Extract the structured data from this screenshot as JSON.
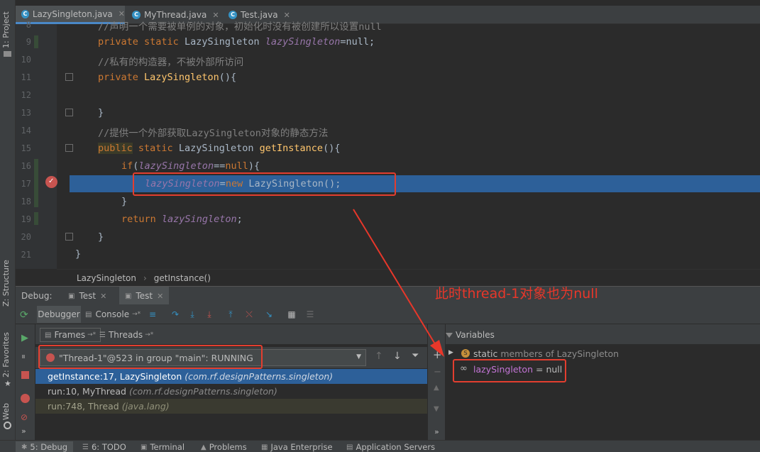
{
  "editor_tabs": [
    {
      "name": "LazySingleton.java",
      "active": true
    },
    {
      "name": "MyThread.java",
      "active": false
    },
    {
      "name": "Test.java",
      "active": false
    }
  ],
  "left_tabs": {
    "project": "1: Project",
    "structure": "Z: Structure",
    "favorites": "2: Favorites",
    "web": "Web"
  },
  "line_numbers": [
    "8",
    "9",
    "10",
    "11",
    "12",
    "13",
    "14",
    "15",
    "16",
    "17",
    "18",
    "19",
    "20",
    "21"
  ],
  "code": {
    "line8": "//声明一个需要被单例的对象，初始化时没有被创建所以设置null",
    "line9_kw": "private static",
    "line9_type": "LazySingleton",
    "line9_field": "lazySingleton",
    "line9_rest": "=null;",
    "line10": "//私有的构造器，不被外部所访问",
    "line11_kw": "private",
    "line11_name": "LazySingleton",
    "line11_rest": "(){",
    "line13": "}",
    "line14": "//提供一个外部获取LazySingleton对象的静态方法",
    "line15_kw1": "public",
    "line15_kw2": "static",
    "line15_type": "LazySingleton",
    "line15_method": "getInstance",
    "line15_rest": "(){",
    "line16_kw": "if",
    "line16_open": "(",
    "line16_field": "lazySingleton",
    "line16_op": "==",
    "line16_null": "null",
    "line16_rest": "){",
    "line17_field": "lazySingleton",
    "line17_op": "=",
    "line17_kw": "new",
    "line17_rest": "LazySingleton();",
    "line18": "}",
    "line19_kw": "return",
    "line19_field": "lazySingleton",
    "line19_rest": ";",
    "line20": "}",
    "line21": "}"
  },
  "breadcrumb": {
    "class": "LazySingleton",
    "sep": "›",
    "method": "getInstance()"
  },
  "debug": {
    "label": "Debug:",
    "sessions": [
      "Test",
      "Test"
    ],
    "tab_debugger": "Debugger",
    "tab_console": "Console",
    "frames_label": "Frames",
    "threads_label": "Threads",
    "thread_selected": "\"Thread-1\"@523 in group \"main\": RUNNING",
    "frames": [
      {
        "method": "getInstance:17, LazySingleton",
        "pkg": "(com.rf.designPatterns.singleton)",
        "selected": true
      },
      {
        "method": "run:10, MyThread",
        "pkg": "(com.rf.designPatterns.singleton)",
        "selected": false
      },
      {
        "method": "run:748, Thread",
        "pkg": "(java.lang)",
        "selected": false
      }
    ],
    "variables_label": "Variables",
    "var_static_kw": "static",
    "var_static_rest": "members of LazySingleton",
    "var_name": "lazySingleton",
    "var_eq": "=",
    "var_value": "null"
  },
  "annotation": "此时thread-1对象也为null",
  "statusbar": [
    "5: Debug",
    "6: TODO",
    "Terminal",
    "Problems",
    "Java Enterprise",
    "Application Servers"
  ],
  "colors": {
    "accent_blue": "#2d6099",
    "annotation_red": "#e33e2f",
    "keyword_orange": "#cc7832",
    "field_purple": "#9876aa"
  }
}
